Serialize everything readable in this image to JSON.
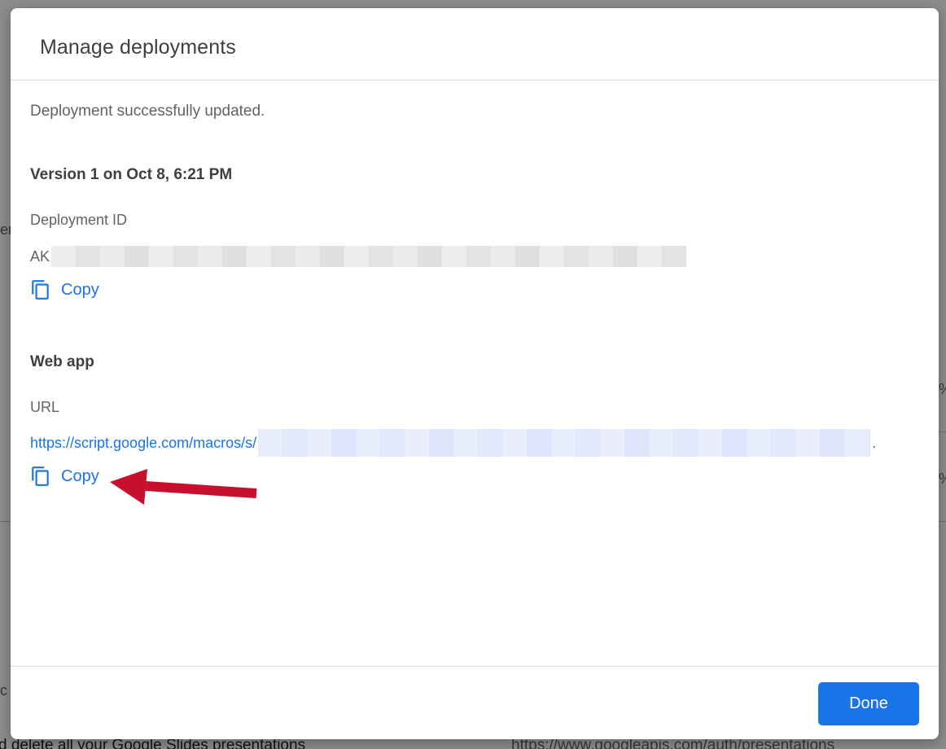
{
  "dialog": {
    "title": "Manage deployments",
    "status_message": "Deployment successfully updated.",
    "version_heading": "Version 1 on Oct 8, 6:21 PM",
    "deployment": {
      "label": "Deployment ID",
      "value_prefix": "AK",
      "copy_label": "Copy"
    },
    "web_app": {
      "heading": "Web app",
      "url_label": "URL",
      "url_prefix": "https://script.google.com/macros/s/",
      "url_suffix": ".",
      "copy_label": "Copy"
    },
    "footer": {
      "done_label": "Done"
    }
  },
  "background": {
    "left_fragments": [
      "er",
      "c"
    ],
    "right_fragments": [
      "%",
      "%"
    ],
    "bottom_left_text": "d delete all your Google Slides presentations",
    "bottom_right_text": "https://www.googleapis.com/auth/presentations"
  },
  "colors": {
    "accent": "#1a73e8",
    "annotation_arrow": "#c8102e",
    "title_text": "#3c4043",
    "secondary_text": "#5f6368"
  },
  "icons": {
    "copy": "copy-icon",
    "arrow": "annotation-arrow-icon"
  }
}
